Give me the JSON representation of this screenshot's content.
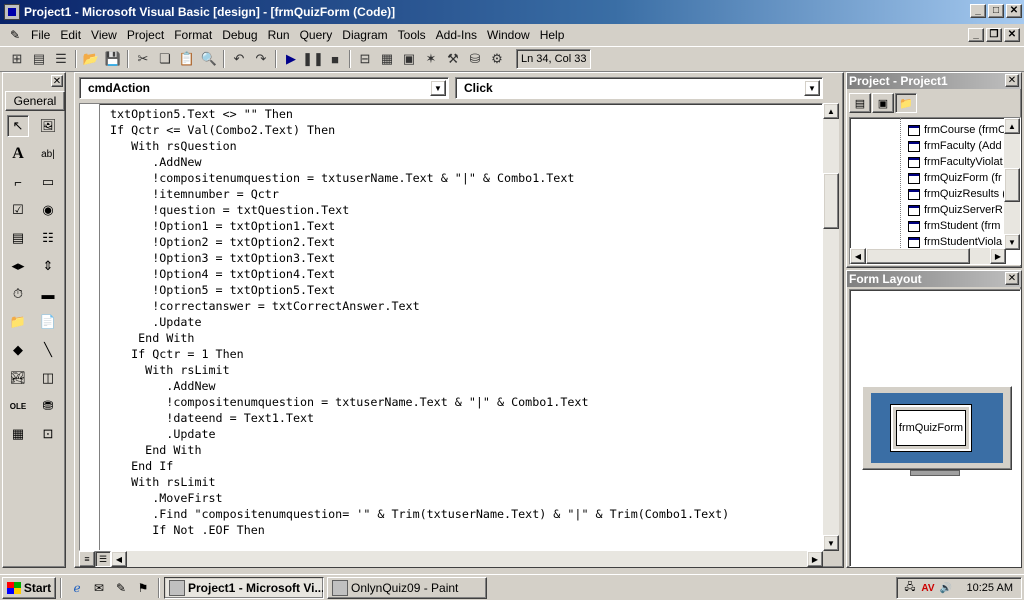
{
  "window": {
    "title": "Project1 - Microsoft Visual Basic [design] - [frmQuizForm (Code)]"
  },
  "menu": {
    "items": [
      "File",
      "Edit",
      "View",
      "Project",
      "Format",
      "Debug",
      "Run",
      "Query",
      "Diagram",
      "Tools",
      "Add-Ins",
      "Window",
      "Help"
    ]
  },
  "toolbar": {
    "position": "Ln 34, Col 33"
  },
  "toolbox": {
    "tab_label": "General"
  },
  "code_window": {
    "object_combo": "cmdAction",
    "procedure_combo": "Click",
    "lines": [
      "txtOption5.Text <> \"\" Then",
      "If Qctr <= Val(Combo2.Text) Then",
      "   With rsQuestion",
      "      .AddNew",
      "      !compositenumquestion = txtuserName.Text & \"|\" & Combo1.Text",
      "      !itemnumber = Qctr",
      "      !question = txtQuestion.Text",
      "      !Option1 = txtOption1.Text",
      "      !Option2 = txtOption2.Text",
      "      !Option3 = txtOption3.Text",
      "      !Option4 = txtOption4.Text",
      "      !Option5 = txtOption5.Text",
      "      !correctanswer = txtCorrectAnswer.Text",
      "      .Update",
      "    End With",
      "   If Qctr = 1 Then",
      "     With rsLimit",
      "        .AddNew",
      "        !compositenumquestion = txtuserName.Text & \"|\" & Combo1.Text",
      "        !dateend = Text1.Text",
      "        .Update",
      "     End With",
      "   End If",
      "   With rsLimit",
      "      .MoveFirst",
      "      .Find \"compositenumquestion= '\" & Trim(txtuserName.Text) & \"|\" & Trim(Combo1.Text)",
      "      If Not .EOF Then"
    ]
  },
  "project_explorer": {
    "title": "Project - Project1",
    "items": [
      "frmCourse (frmC",
      "frmFaculty (Add",
      "frmFacultyViolat",
      "frmQuizForm (fr",
      "frmQuizResults (",
      "frmQuizServerR",
      "frmStudent (frm",
      "frmStudentViola"
    ]
  },
  "form_layout": {
    "title": "Form Layout",
    "form_label": "frmQuizForm"
  },
  "taskbar": {
    "start_label": "Start",
    "tasks": [
      "Project1 - Microsoft Vi...",
      "OnlynQuiz09 - Paint"
    ],
    "clock": "10:25 AM"
  }
}
